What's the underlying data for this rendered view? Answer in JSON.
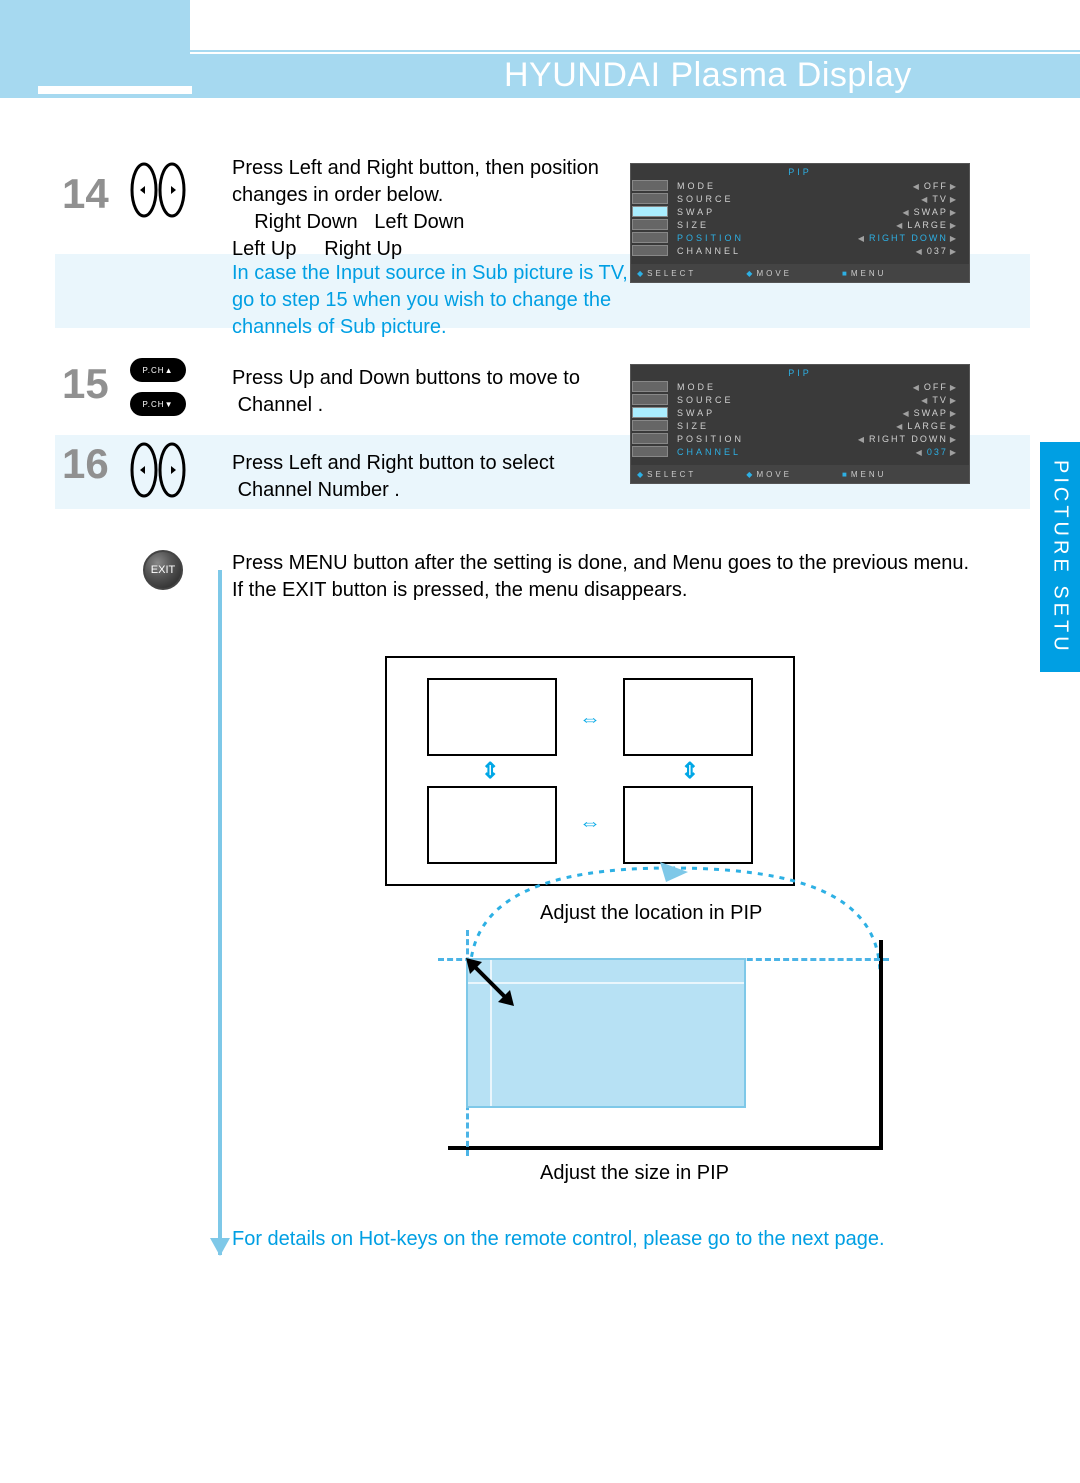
{
  "header": {
    "title": "HYUNDAI Plasma Display"
  },
  "side_tab": "PICTURE SETU",
  "steps": {
    "s14": {
      "num": "14",
      "text_a1": "Press Left and Right button, then position",
      "text_a2": "changes in order below.",
      "seq1": "Right Down",
      "seq2": "Left Down",
      "seq3": "Left Up",
      "seq4": "Right Up",
      "note1": "In case the Input source in Sub picture is TV,",
      "note2": "go to step 15 when you wish to change the",
      "note3": "channels of Sub picture."
    },
    "s15": {
      "num": "15",
      "text1": "Press Up and Down buttons to move to",
      "text2": "Channel ."
    },
    "s16": {
      "num": "16",
      "text1": "Press Left and Right button to select",
      "text2": "Channel Number ."
    },
    "exit": {
      "label": "EXIT",
      "text1": "Press MENU button after the setting is done, and Menu goes to the previous menu.",
      "text2": "If the EXIT button is pressed, the menu disappears."
    }
  },
  "ud_label_up": "P.CH▲",
  "ud_label_dn": "P.CH▼",
  "osd": {
    "title": "PIP",
    "rows": [
      {
        "label": "MODE",
        "value": "OFF"
      },
      {
        "label": "SOURCE",
        "value": "TV"
      },
      {
        "label": "SWAP",
        "value": "SWAP"
      },
      {
        "label": "SIZE",
        "value": "LARGE"
      },
      {
        "label": "POSITION",
        "value": "RIGHT DOWN"
      },
      {
        "label": "CHANNEL",
        "value": "037"
      }
    ],
    "foot": {
      "a": "SELECT",
      "b": "MOVE",
      "c": "MENU"
    },
    "hl1": 4,
    "hl2": 5
  },
  "diagram": {
    "pos_label": "Adjust the location in PIP",
    "size_label": "Adjust the size in PIP"
  },
  "footer_note": "For details on Hot-keys on the remote control, please go to the next page."
}
